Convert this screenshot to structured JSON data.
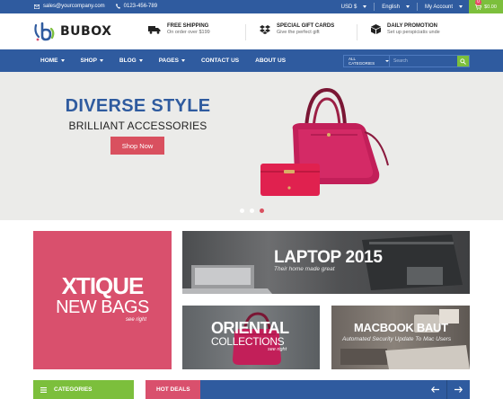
{
  "topbar": {
    "email": "sales@yourcompany.com",
    "phone": "0123-456-789",
    "currency": "USD $",
    "language": "English",
    "account": "My Account",
    "cart_count": "0",
    "cart_total": "$0.00"
  },
  "brand": {
    "name": "BUBOX"
  },
  "features": [
    {
      "title": "Free Shipping",
      "subtitle": "On order over $199",
      "icon": "truck-icon"
    },
    {
      "title": "Special Gift Cards",
      "subtitle": "Give the perfect gift",
      "icon": "dropbox-icon"
    },
    {
      "title": "Daily Promotion",
      "subtitle": "Set up perspiciatis unde",
      "icon": "box-icon"
    }
  ],
  "nav": {
    "items": [
      "HOME",
      "SHOP",
      "BLOG",
      "PAGES",
      "CONTACT US",
      "ABOUT US"
    ],
    "search_category": "ALL CATEGORIES",
    "search_placeholder": "Search"
  },
  "hero": {
    "title": "DIVERSE STYLE",
    "subtitle": "BRILLIANT ACCESSORIES",
    "cta": "Shop Now",
    "slide_count": 3,
    "active_slide": 3
  },
  "banners": {
    "left": {
      "line1": "XTIQUE",
      "line2": "NEW BAGS",
      "line3": "see right"
    },
    "laptop": {
      "title": "LAPTOP 2015",
      "subtitle": "Their home made great"
    },
    "oriental": {
      "title": "ORIENTAL",
      "subtitle": "COLLECTIONS",
      "tag": "see right"
    },
    "macbook": {
      "title": "MACBOOK BAUT",
      "subtitle": "Automated Security Update To Mac Users"
    }
  },
  "bottom": {
    "categories_label": "CATEGORIES",
    "hot_deals_label": "HOT DEALS"
  },
  "colors": {
    "primary": "#2f5b9f",
    "accent_green": "#7cbf3c",
    "accent_pink": "#d9506d",
    "hero_bg": "#ebebe9"
  }
}
